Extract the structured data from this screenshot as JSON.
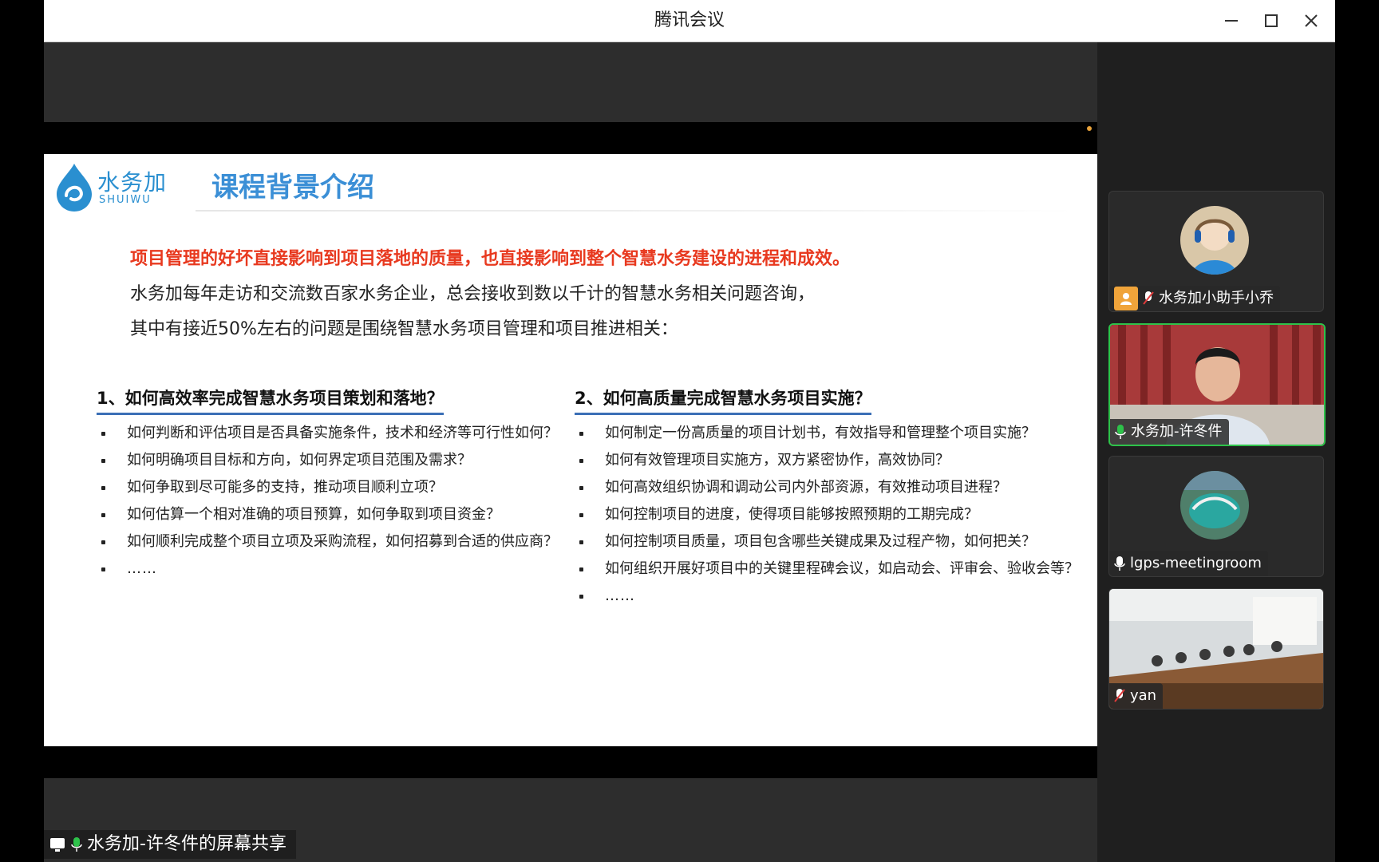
{
  "window": {
    "title": "腾讯会议"
  },
  "slide": {
    "logo_cn": "水务加",
    "logo_en": "SHUIWU",
    "title": "课程背景介绍",
    "intro": [
      "项目管理的好坏直接影响到项目落地的质量，也直接影响到整个智慧水务建设的进程和成效。",
      "水务加每年走访和交流数百家水务企业，总会接收到数以千计的智慧水务相关问题咨询，",
      "其中有接近50%左右的问题是围绕智慧水务项目管理和项目推进相关："
    ],
    "left_column": {
      "heading": "1、如何高效率完成智慧水务项目策划和落地？",
      "items": [
        "如何判断和评估项目是否具备实施条件，技术和经济等可行性如何？",
        "如何明确项目目标和方向，如何界定项目范围及需求？",
        "如何争取到尽可能多的支持，推动项目顺利立项？",
        "如何估算一个相对准确的项目预算，如何争取到项目资金？",
        "如何顺利完成整个项目立项及采购流程，如何招募到合适的供应商？",
        "……"
      ]
    },
    "right_column": {
      "heading": "2、如何高质量完成智慧水务项目实施？",
      "items": [
        "如何制定一份高质量的项目计划书，有效指导和管理整个项目实施？",
        "如何有效管理项目实施方，双方紧密协作，高效协同？",
        "如何高效组织协调和调动公司内外部资源，有效推动项目进程？",
        "如何控制项目的进度，使得项目能够按照预期的工期完成？",
        "如何控制项目质量，项目包含哪些关键成果及过程产物，如何把关？",
        "如何组织开展好项目中的关键里程碑会议，如启动会、评审会、验收会等？",
        "……"
      ]
    }
  },
  "share_label": "水务加-许冬件的屏幕共享",
  "participants": [
    {
      "name": "水务加小助手小乔",
      "mic": "muted",
      "host": true
    },
    {
      "name": "水务加-许冬件",
      "mic": "active",
      "speaking": true
    },
    {
      "name": "lgps-meetingroom",
      "mic": "on"
    },
    {
      "name": "yan",
      "mic": "muted"
    }
  ],
  "colors": {
    "accent_green": "#2ec24a",
    "slide_red": "#e8391f",
    "slide_blue": "#3b8fd6"
  }
}
